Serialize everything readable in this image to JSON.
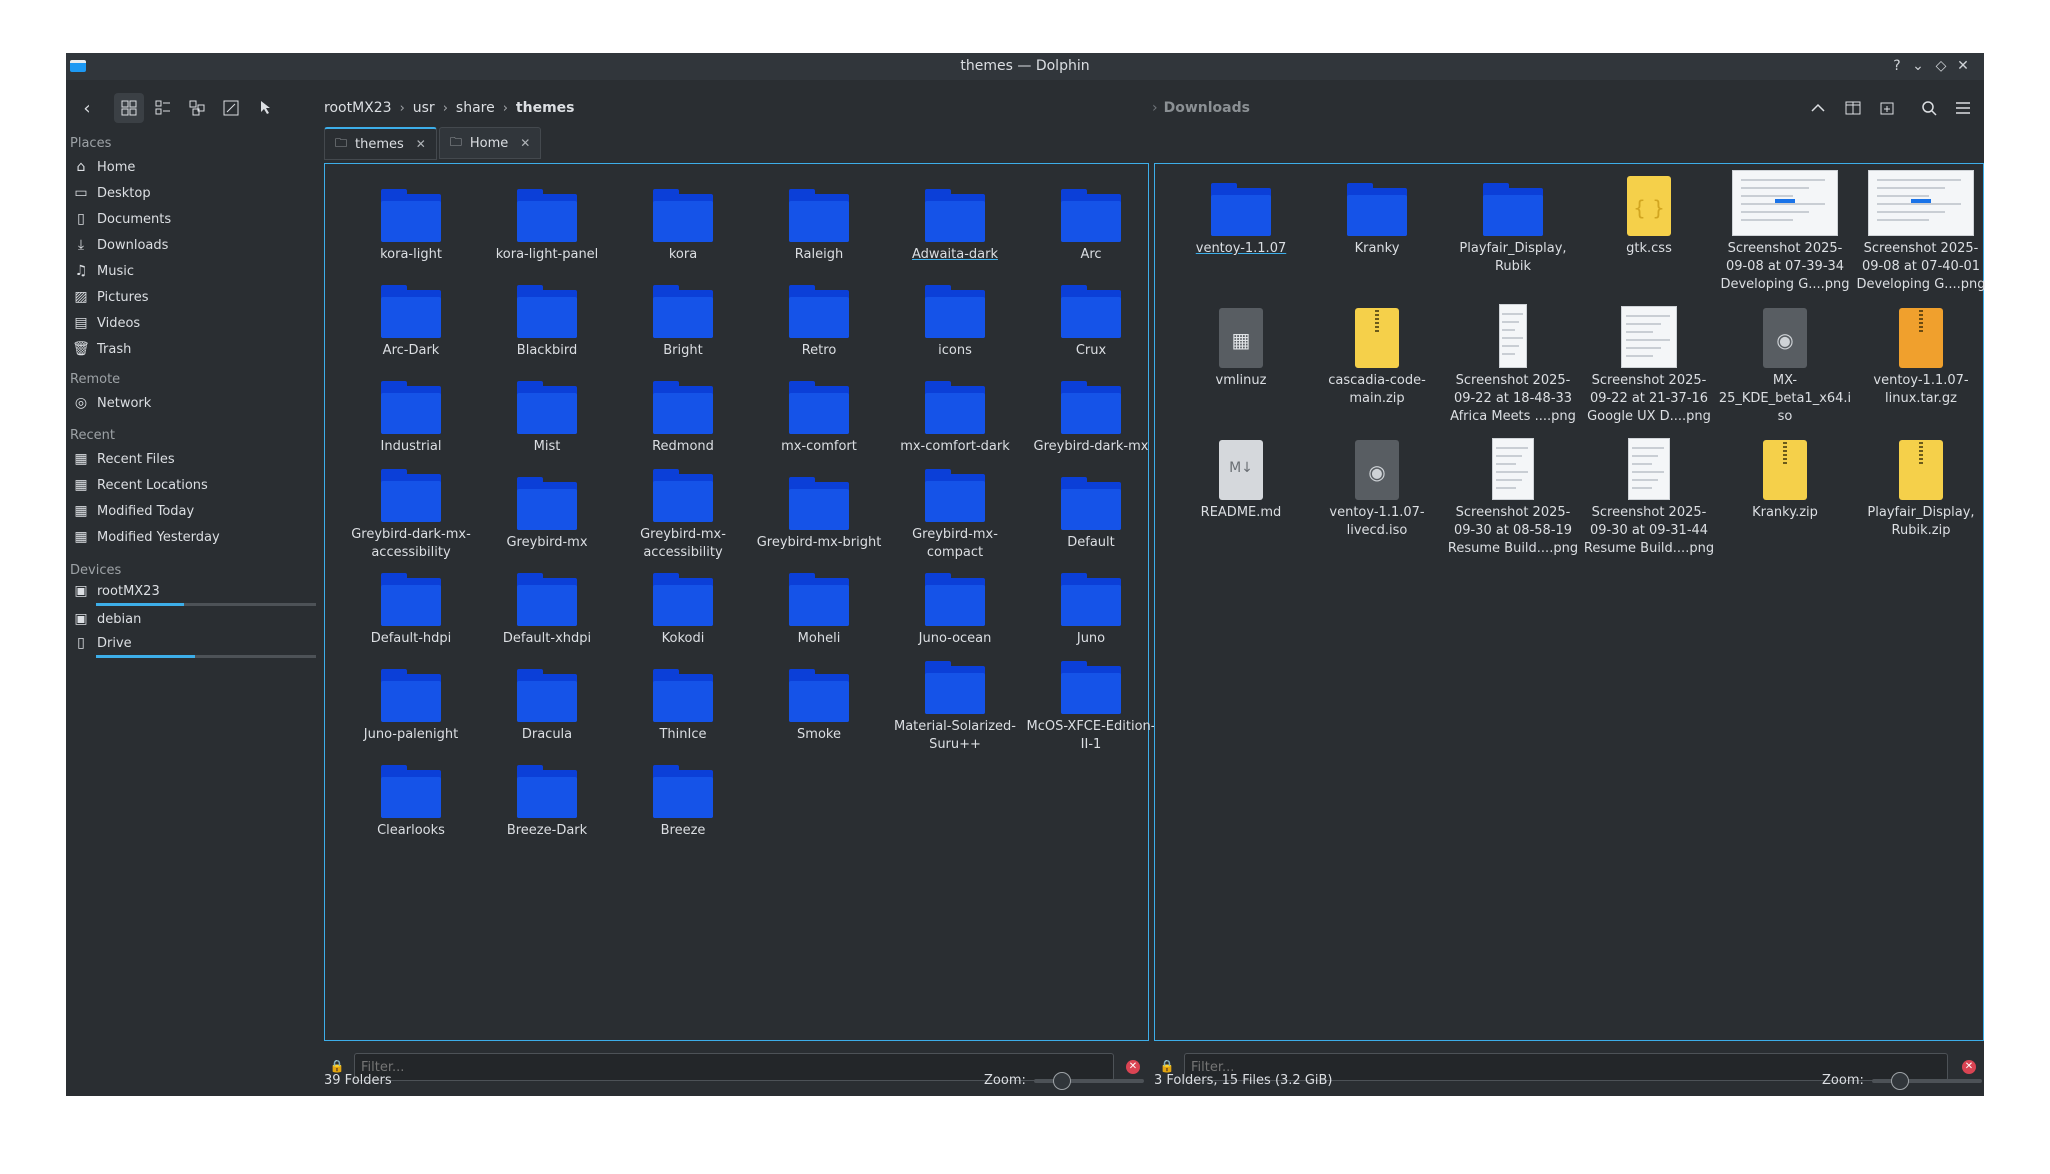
{
  "window": {
    "title": "themes — Dolphin"
  },
  "breadcrumb": {
    "parts": [
      "rootMX23",
      "usr",
      "share"
    ],
    "current": "themes"
  },
  "right_breadcrumb": {
    "current": "Downloads"
  },
  "sidebar": {
    "places_heading": "Places",
    "places": [
      "Home",
      "Desktop",
      "Documents",
      "Downloads",
      "Music",
      "Pictures",
      "Videos",
      "Trash"
    ],
    "remote_heading": "Remote",
    "remote": [
      "Network"
    ],
    "recent_heading": "Recent",
    "recent": [
      "Recent Files",
      "Recent Locations",
      "Modified Today",
      "Modified Yesterday"
    ],
    "devices_heading": "Devices",
    "devices": [
      {
        "label": "rootMX23",
        "usage": 0.4
      },
      {
        "label": "debian"
      },
      {
        "label": "Drive",
        "usage": 0.45
      }
    ]
  },
  "tabs": [
    "themes",
    "Home"
  ],
  "left_pane": {
    "folders": [
      "kora-light",
      "kora-light-panel",
      "kora",
      "Raleigh",
      "Adwaita-dark",
      "Arc",
      "Arc-Dark",
      "Blackbird",
      "Bright",
      "Retro",
      "icons",
      "Crux",
      "Industrial",
      "Mist",
      "Redmond",
      "mx-comfort",
      "mx-comfort-dark",
      "Greybird-dark-mx",
      "Greybird-dark-mx-accessibility",
      "Greybird-mx",
      "Greybird-mx-accessibility",
      "Greybird-mx-bright",
      "Greybird-mx-compact",
      "Default",
      "Default-hdpi",
      "Default-xhdpi",
      "Kokodi",
      "Moheli",
      "Juno-ocean",
      "Juno",
      "Juno-palenight",
      "Dracula",
      "ThinIce",
      "Smoke",
      "Material-Solarized-Suru++",
      "McOS-XFCE-Edition-II-1",
      "Clearlooks",
      "Breeze-Dark",
      "Breeze"
    ],
    "filter_placeholder": "Filter...",
    "status": "39 Folders",
    "zoom_label": "Zoom:",
    "zoom_level": 0.25
  },
  "right_pane": {
    "items": [
      {
        "name": "ventoy-1.1.07",
        "kind": "folder"
      },
      {
        "name": "Kranky",
        "kind": "folder"
      },
      {
        "name": "Playfair_Display, Rubik",
        "kind": "folder"
      },
      {
        "name": "gtk.css",
        "kind": "css"
      },
      {
        "name": "Screenshot 2025-09-08 at 07-39-34 Developing G....png",
        "kind": "shot-wide"
      },
      {
        "name": "Screenshot 2025-09-08 at 07-40-01 Developing G....png",
        "kind": "shot-wide"
      },
      {
        "name": "vmlinuz",
        "kind": "bin"
      },
      {
        "name": "cascadia-code-main.zip",
        "kind": "zip"
      },
      {
        "name": "Screenshot 2025-09-22 at 18-48-33 Africa Meets ....png",
        "kind": "shot-tall"
      },
      {
        "name": "Screenshot 2025-09-22 at 21-37-16 Google UX D....png",
        "kind": "shot-sheet"
      },
      {
        "name": "MX-25_KDE_beta1_x64.iso",
        "kind": "iso"
      },
      {
        "name": "ventoy-1.1.07-linux.tar.gz",
        "kind": "tgz"
      },
      {
        "name": "README.md",
        "kind": "md"
      },
      {
        "name": "ventoy-1.1.07-livecd.iso",
        "kind": "iso"
      },
      {
        "name": "Screenshot 2025-09-30 at 08-58-19 Resume Build....png",
        "kind": "shot-doc"
      },
      {
        "name": "Screenshot 2025-09-30 at 09-31-44 Resume Build....png",
        "kind": "shot-doc"
      },
      {
        "name": "Kranky.zip",
        "kind": "zip"
      },
      {
        "name": "Playfair_Display, Rubik.zip",
        "kind": "zip"
      }
    ],
    "filter_placeholder": "Filter...",
    "status": "3 Folders, 15 Files (3.2 GiB)",
    "zoom_label": "Zoom:",
    "zoom_level": 0.25
  },
  "colors": {
    "accent": "#3daee9",
    "folder": "#1553e8",
    "background": "#2a2e32"
  }
}
